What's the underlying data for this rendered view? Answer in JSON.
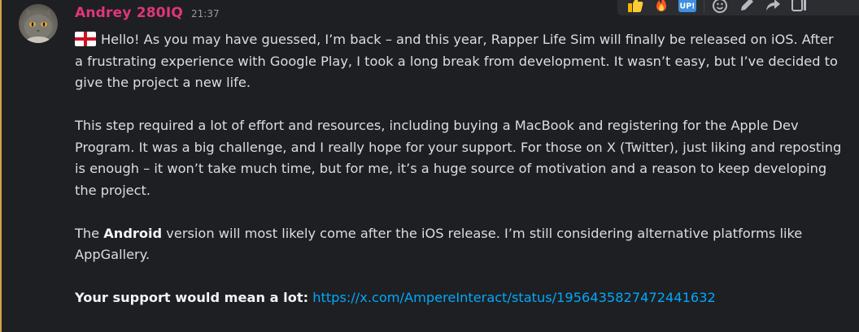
{
  "author": {
    "name": "Andrey 280IQ",
    "timestamp": "21:37",
    "name_color": "#e0357b"
  },
  "message": {
    "paragraph1": "Hello! As you may have guessed, I’m back – and this year, Rapper Life Sim will finally be released on iOS. After a frustrating experience with Google Play, I took a long break from development. It wasn’t easy, but I’ve decided to give the project a new life.",
    "paragraph2": "This step required a lot of effort and resources, including buying a MacBook and registering for the Apple Dev Program. It was a big challenge, and I really hope for your support. For those on X (Twitter), just liking and reposting is enough – it won’t take much time, but for me, it’s a huge source of motivation and a reason to keep developing the project.",
    "paragraph3_prefix": "The ",
    "paragraph3_bold": "Android",
    "paragraph3_suffix": " version will most likely come after the iOS release. I’m still considering alternative platforms like AppGallery.",
    "support_label": "Your support would mean a lot:",
    "support_link": "https://x.com/AmpereInteract/status/1956435827472441632"
  },
  "toolbar": {
    "buttons": [
      {
        "name": "thumbs-up-icon"
      },
      {
        "name": "fire-icon"
      },
      {
        "name": "up-icon",
        "text": "UP!"
      },
      {
        "name": "add-reaction-icon"
      },
      {
        "name": "edit-icon"
      },
      {
        "name": "forward-icon"
      },
      {
        "name": "thread-icon"
      }
    ]
  },
  "colors": {
    "background": "#1e1f22",
    "text": "#dbdee1",
    "link": "#00a8fc",
    "highlight_bar": "#d4a14a"
  }
}
